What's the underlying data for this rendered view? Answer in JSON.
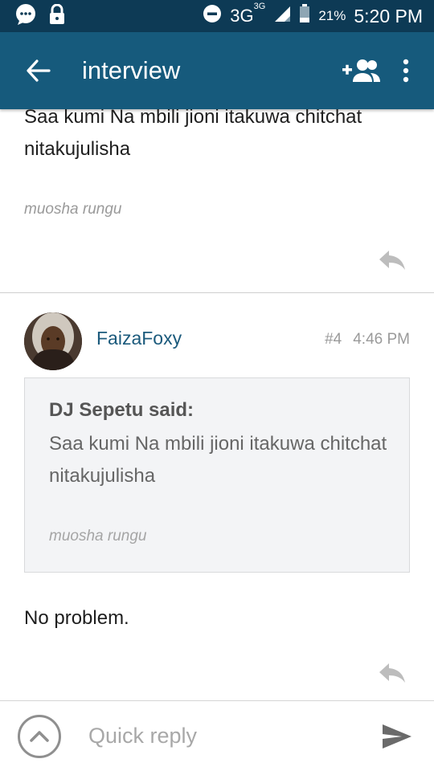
{
  "status_bar": {
    "network": "3G",
    "network_sup": "3G",
    "battery_percent": "21%",
    "time": "5:20 PM",
    "icons": [
      "chat-bubble-icon",
      "lock-icon",
      "dnd-icon",
      "signal-icon",
      "battery-icon"
    ]
  },
  "app_bar": {
    "title": "interview",
    "icons": [
      "back-arrow-icon",
      "add-person-icon",
      "more-vert-icon"
    ]
  },
  "posts": [
    {
      "text": "Saa kumi Na mbili jioni itakuwa chitchat nitakujulisha",
      "signature": "muosha rungu"
    },
    {
      "author": "FaizaFoxy",
      "number": "#4",
      "time": "4:46 PM",
      "quote": {
        "author": "DJ Sepetu said:",
        "text": "Saa kumi Na mbili jioni itakuwa chitchat nitakujulisha",
        "signature": "muosha rungu"
      },
      "text": "No problem."
    }
  ],
  "bottom_bar": {
    "placeholder": "Quick reply"
  },
  "colors": {
    "status_bar": "#0d3a55",
    "app_bar": "#165a7c",
    "author_link": "#1b5a7c"
  }
}
